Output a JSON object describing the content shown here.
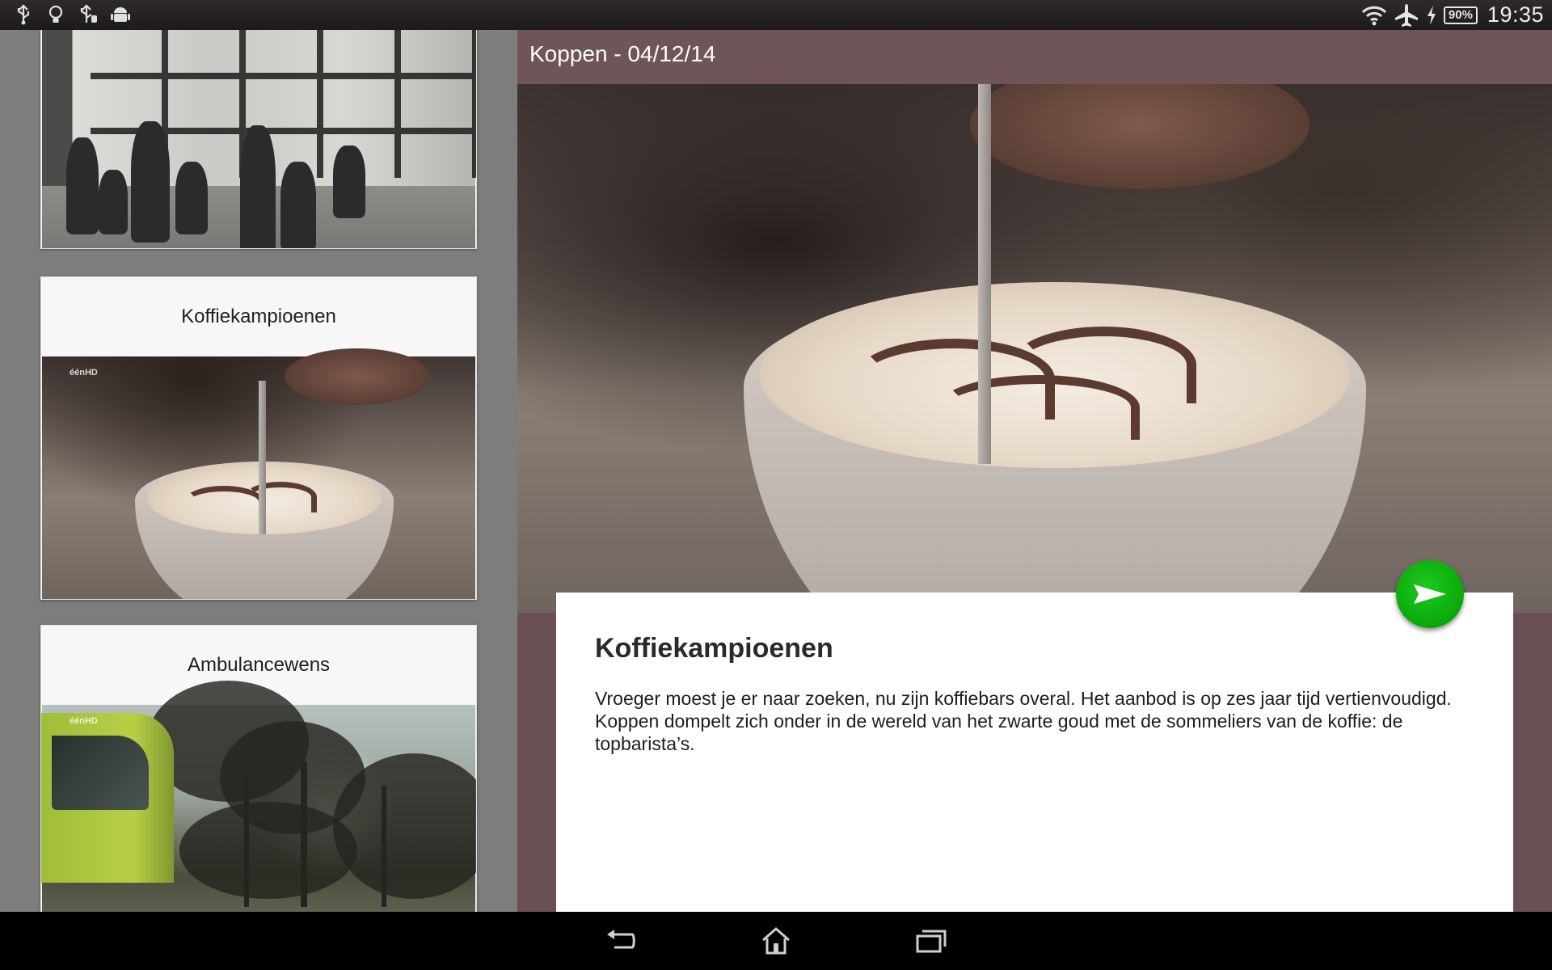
{
  "status_bar": {
    "icons_left": [
      "usb-icon",
      "bulb-icon",
      "usb-debug-icon",
      "android-icon"
    ],
    "icons_right": [
      "wifi-icon",
      "airplane-mode-icon",
      "charging-icon"
    ],
    "battery_level": "90%",
    "time": "19:35"
  },
  "list": {
    "items": [
      {
        "title": "",
        "thumbnail": "station-scene"
      },
      {
        "title": "Koffiekampioenen",
        "thumbnail": "coffee-latte-scene",
        "channel_logo": "éénHD"
      },
      {
        "title": "Ambulancewens",
        "thumbnail": "trees-ambulance-scene",
        "channel_logo": "éénHD"
      }
    ]
  },
  "detail": {
    "header_title": "Koppen - 04/12/14",
    "hero_image": "coffee-latte-scene",
    "title": "Koffiekampioenen",
    "description": "Vroeger moest je er naar zoeken, nu zijn koffiebars overal. Het aanbod is op zes jaar tijd vertienvoudigd. Koppen dompelt zich onder in de wereld van het zwarte goud met de sommeliers van de koffie: de topbarista’s.",
    "play_button_icon": "play-icon",
    "colors": {
      "header": "#6f5558",
      "play_button": "#0aa80a"
    }
  },
  "nav_bar": {
    "buttons": [
      "back-icon",
      "home-icon",
      "recent-apps-icon"
    ]
  }
}
